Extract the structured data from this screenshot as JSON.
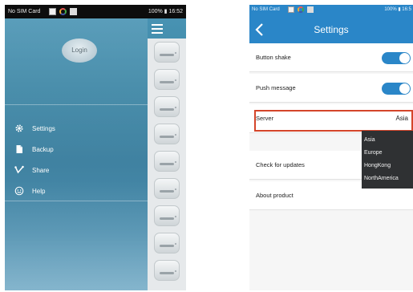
{
  "left_phone": {
    "statusbar": {
      "carrier": "No SIM Card",
      "right": "100% ▮ 16:52"
    },
    "login_label": "Login",
    "menu": [
      {
        "label": "Settings",
        "icon": "gear-icon"
      },
      {
        "label": "Backup",
        "icon": "backup-icon"
      },
      {
        "label": "Share",
        "icon": "share-icon"
      },
      {
        "label": "Help",
        "icon": "smiley-icon"
      }
    ]
  },
  "right_phone": {
    "statusbar": {
      "carrier": "No SIM Card",
      "right": "100% ▮ 16:5"
    },
    "title": "Settings",
    "rows": {
      "button_shake": "Button shake",
      "push_message": "Push message",
      "server": "Server",
      "server_value": "Asia",
      "check_updates": "Check for updates",
      "about": "About product"
    },
    "server_options": [
      "Asia",
      "Europe",
      "HongKong",
      "NorthAmerica"
    ]
  },
  "colors": {
    "accent": "#2a86c8",
    "highlight": "#d4452a",
    "dropdown_bg": "#2f3133"
  }
}
